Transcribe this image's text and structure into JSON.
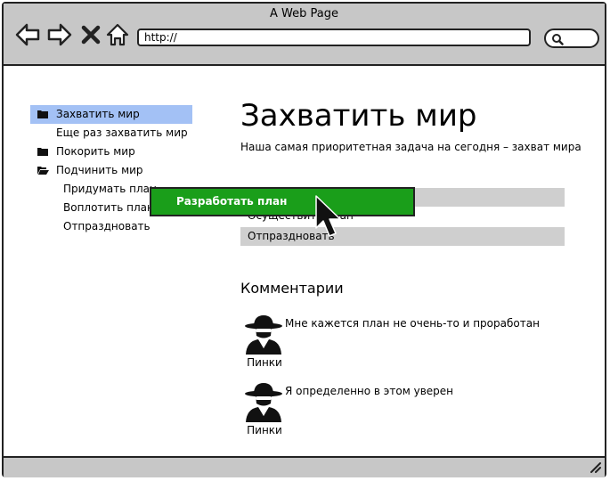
{
  "window": {
    "title": "A Web Page",
    "url": "http://"
  },
  "sidebar": {
    "items": [
      {
        "label": "Захватить мир",
        "icon": "folder-icon",
        "active": true
      },
      {
        "label": "Еще раз захватить мир",
        "icon": "",
        "active": false
      },
      {
        "label": "Покорить мир",
        "icon": "folder-icon",
        "active": false
      },
      {
        "label": "Подчинить мир",
        "icon": "folder-open-icon",
        "active": false
      },
      {
        "label": "Придумать план",
        "icon": "",
        "active": false
      },
      {
        "label": "Воплотить план",
        "icon": "",
        "active": false
      },
      {
        "label": "Отпраздновать",
        "icon": "",
        "active": false
      }
    ]
  },
  "main": {
    "title": "Захватить мир",
    "subtitle": "Наша самая приоритетная задача на сегодня – захват мира",
    "tasks": [
      {
        "label": "Разработать план"
      },
      {
        "label": "Осуществить план"
      },
      {
        "label": "Отпраздновать"
      }
    ],
    "drag_item_label": "Разработать план",
    "comments_heading": "Комментарии",
    "comments": [
      {
        "author": "Пинки",
        "text": "Мне кажется план не очень-то и проработан",
        "avatar": "spy-avatar-icon"
      },
      {
        "author": "Пинки",
        "text": "Я определенно в этом уверен",
        "avatar": "spy-avatar-icon"
      }
    ]
  },
  "colors": {
    "chrome": "#c7c7c7",
    "selection": "#a3c1f5",
    "drag_item": "#1a9e1a",
    "task_row": "#cfcfcf"
  }
}
